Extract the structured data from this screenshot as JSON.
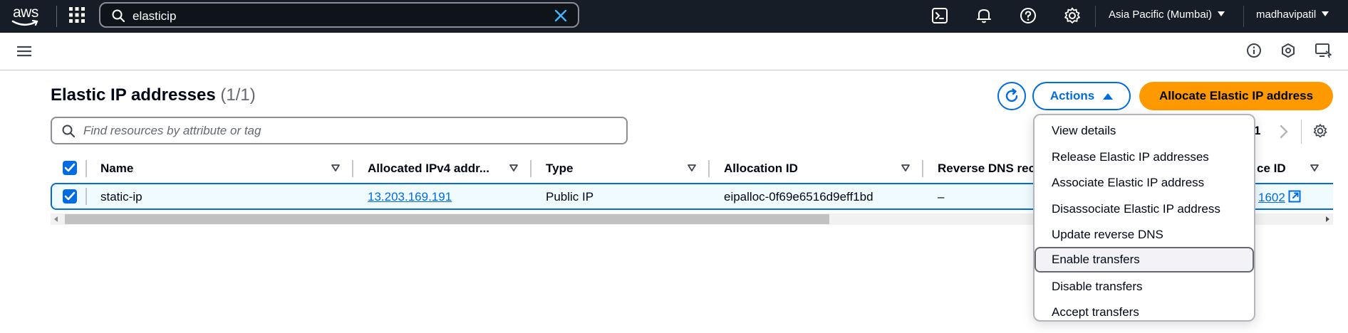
{
  "topnav": {
    "logo_text": "aws",
    "search_value": "elasticip",
    "region": "Asia Pacific (Mumbai)",
    "user": "madhavipatil"
  },
  "page": {
    "title": "Elastic IP addresses",
    "count": "(1/1)",
    "actions_label": "Actions",
    "allocate_label": "Allocate Elastic IP address",
    "filter_placeholder": "Find resources by attribute or tag",
    "current_page": "1"
  },
  "table": {
    "columns": [
      "Name",
      "Allocated IPv4 addr...",
      "Type",
      "Allocation ID",
      "Reverse DNS rec",
      "ce ID"
    ],
    "rows": [
      {
        "name": "static-ip",
        "ip": "13.203.169.191",
        "type": "Public IP",
        "allocation_id": "eipalloc-0f69e6516d9eff1bd",
        "reverse_dns": "–",
        "instance_id": "1602"
      }
    ]
  },
  "menu": {
    "items": [
      "View details",
      "Release Elastic IP addresses",
      "Associate Elastic IP address",
      "Disassociate Elastic IP address",
      "Update reverse DNS",
      "Enable transfers",
      "Disable transfers",
      "Accept transfers"
    ],
    "hovered_index": 5
  },
  "colors": {
    "nav_bg": "#161d26",
    "primary_blue": "#006ce0",
    "accent_orange": "#ff9900",
    "selected_row_bg": "#f0fbff"
  }
}
